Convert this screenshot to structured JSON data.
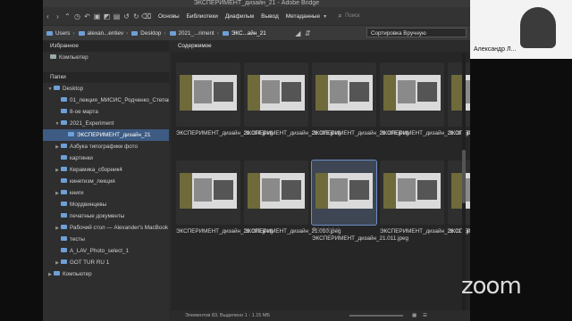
{
  "window": {
    "title": "ЭКСПЕРИМЕНТ_дизайн_21 - Adobe Bridge"
  },
  "toolbar": {
    "menus": [
      "Основы",
      "Библиотеки",
      "Диафильм",
      "Вывод",
      "Метаданные"
    ],
    "search_placeholder": "Поиск"
  },
  "pathbar": {
    "crumbs": [
      "Users",
      "alexan...entiev",
      "Desktop",
      "2021_...riment",
      "ЭКС...айн_21"
    ],
    "sort_label": "Сортировка Вручную"
  },
  "sidebar": {
    "favorites_tab": "Избранное",
    "favorites": [
      "Компьютер"
    ],
    "folders_tab": "Папки",
    "tree": [
      {
        "label": "Desktop",
        "indent": 0,
        "arrow": "down"
      },
      {
        "label": "01_лекция_МИСИС_Родченко_Степанова",
        "indent": 1,
        "arrow": ""
      },
      {
        "label": "8-ое марта",
        "indent": 1,
        "arrow": ""
      },
      {
        "label": "2021_Experiment",
        "indent": 1,
        "arrow": "down"
      },
      {
        "label": "ЭКСПЕРИМЕНТ_дизайн_21",
        "indent": 2,
        "arrow": "",
        "selected": true
      },
      {
        "label": "Азбука типографики фото",
        "indent": 1,
        "arrow": "right"
      },
      {
        "label": "картинки",
        "indent": 1,
        "arrow": ""
      },
      {
        "label": "Керамика_сборник4",
        "indent": 1,
        "arrow": "right"
      },
      {
        "label": "кинетизм_лекция",
        "indent": 1,
        "arrow": ""
      },
      {
        "label": "книги",
        "indent": 1,
        "arrow": "right"
      },
      {
        "label": "Мордвинцевы",
        "indent": 1,
        "arrow": ""
      },
      {
        "label": "печатные документы",
        "indent": 1,
        "arrow": ""
      },
      {
        "label": "Рабочий стол — Alexander's MacBook Air",
        "indent": 1,
        "arrow": "right"
      },
      {
        "label": "тесты",
        "indent": 1,
        "arrow": ""
      },
      {
        "label": "A_LAV_Photo_select_1",
        "indent": 1,
        "arrow": ""
      },
      {
        "label": "GOT TUR RU 1",
        "indent": 1,
        "arrow": "right"
      },
      {
        "label": "Компьютер",
        "indent": 0,
        "arrow": "right"
      }
    ]
  },
  "content": {
    "tab": "Содержимое",
    "thumbs": [
      {
        "name": "ЭКСПЕРИМЕНТ_дизайн_21.004.jpeg"
      },
      {
        "name": "ЭКСПЕРИМЕНТ_дизайн_21.005.jpeg"
      },
      {
        "name": "ЭКСПЕРИМЕНТ_дизайн_21.006.jpeg"
      },
      {
        "name": "ЭКСПЕРИМЕНТ_дизайн_21.007.jpeg"
      },
      {
        "name": "ЭКСПЕРИМЕНТ_дизайн_21.008.jpeg"
      },
      {
        "name": "ЭКСПЕРИМЕНТ_дизайн_21.009.jpeg"
      },
      {
        "name": "ЭКСПЕРИМЕНТ_дизайн_21.010.jpeg"
      },
      {
        "name": "ЭКСПЕРИМЕНТ_дизайн_21.011.jpeg",
        "selected": true,
        "stars": "⊘☆☆☆☆☆"
      },
      {
        "name": "ЭКСПЕРИМЕНТ_дизайн_21.012.jpeg"
      },
      {
        "name": "ЭКСПЕРИМЕНТ_дизайн_21.013.jpeg"
      }
    ]
  },
  "status": {
    "text": "Элементов 83, Выделено 1 - 1.15 МБ"
  },
  "video": {
    "participant": "Александр Л..."
  },
  "overlay": {
    "logo": "zoom"
  },
  "colors": {
    "selection": "#3d5b83",
    "folder": "#6e9fd6",
    "background": "#2b2b2b"
  }
}
